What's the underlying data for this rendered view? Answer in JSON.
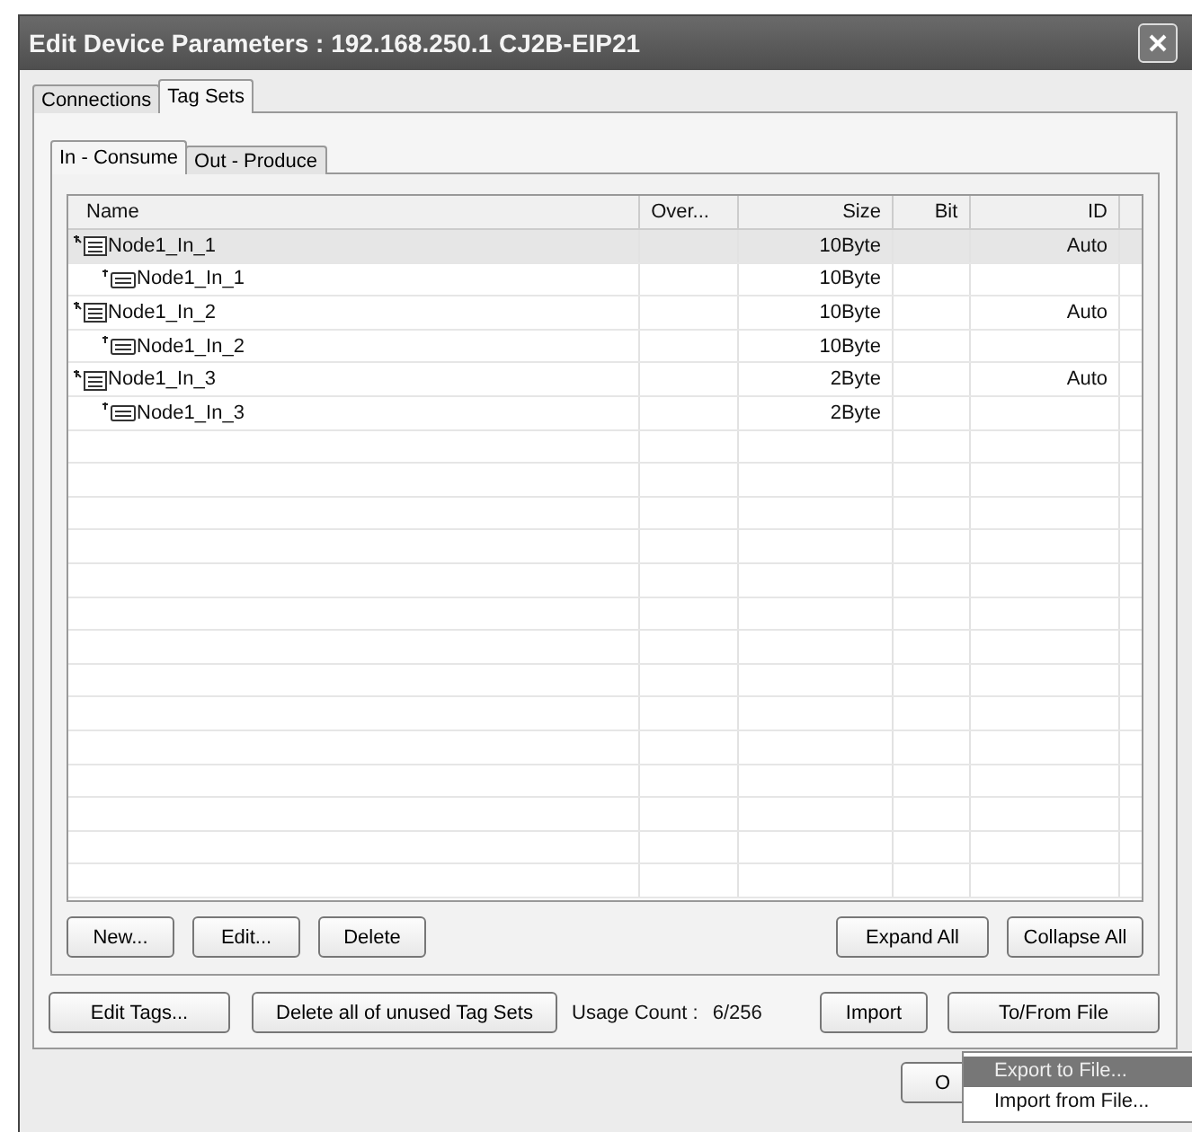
{
  "window": {
    "title": "Edit Device Parameters : 192.168.250.1 CJ2B-EIP21"
  },
  "tabs": [
    {
      "label": "Connections",
      "selected": false
    },
    {
      "label": "Tag Sets",
      "selected": true
    }
  ],
  "subtabs": [
    {
      "label": "In - Consume",
      "selected": true
    },
    {
      "label": "Out - Produce",
      "selected": false
    }
  ],
  "table": {
    "columns": [
      "Name",
      "Over...",
      "Size",
      "Bit",
      "ID"
    ],
    "rows": [
      {
        "name": "Node1_In_1",
        "size": "10Byte",
        "id": "Auto",
        "selected": true,
        "children": [
          {
            "name": "Node1_In_1",
            "size": "10Byte"
          }
        ]
      },
      {
        "name": "Node1_In_2",
        "size": "10Byte",
        "id": "Auto",
        "selected": false,
        "children": [
          {
            "name": "Node1_In_2",
            "size": "10Byte"
          }
        ]
      },
      {
        "name": "Node1_In_3",
        "size": "2Byte",
        "id": "Auto",
        "selected": false,
        "children": [
          {
            "name": "Node1_In_3",
            "size": "2Byte"
          }
        ]
      }
    ]
  },
  "list_buttons_left": [
    "New...",
    "Edit...",
    "Delete"
  ],
  "list_buttons_right": [
    "Expand All",
    "Collapse All"
  ],
  "bottom": {
    "edit_tags": "Edit Tags...",
    "delete_unused": "Delete all of unused Tag Sets",
    "usage_label": "Usage Count :",
    "usage_value": "6/256",
    "import": "Import",
    "to_from_file": "To/From File"
  },
  "menu": [
    {
      "label": "Export to File...",
      "selected": true
    },
    {
      "label": "Import from File...",
      "selected": false
    }
  ],
  "ok_button": "O"
}
